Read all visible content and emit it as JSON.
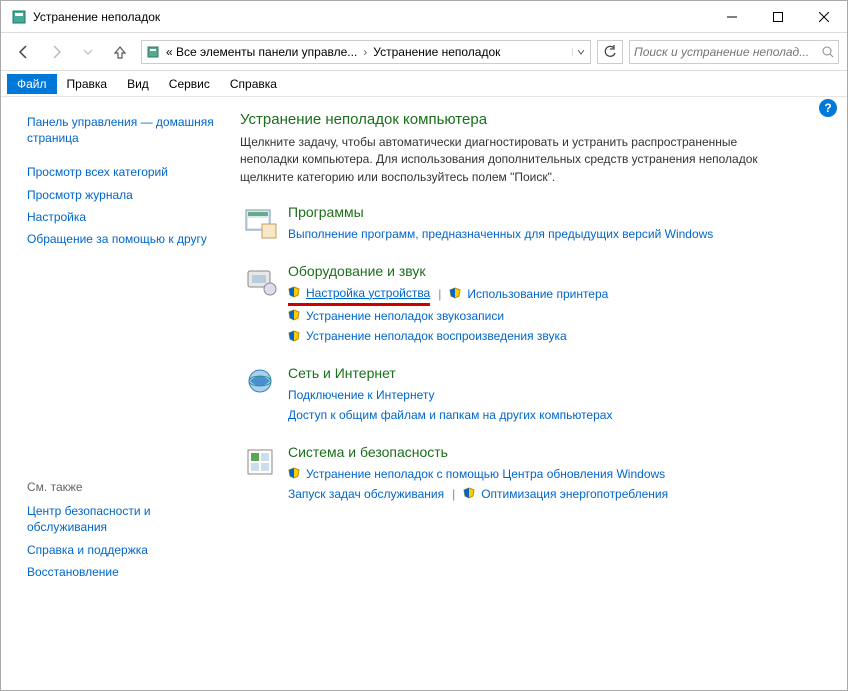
{
  "titlebar": {
    "text": "Устранение неполадок"
  },
  "addressbar": {
    "seg1": "« Все элементы панели управле...",
    "seg2": "Устранение неполадок"
  },
  "search": {
    "placeholder": "Поиск и устранение неполад..."
  },
  "menu": {
    "file": "Файл",
    "edit": "Правка",
    "view": "Вид",
    "tools": "Сервис",
    "help": "Справка"
  },
  "sidebar": {
    "home": "Панель управления — домашняя страница",
    "allcats": "Просмотр всех категорий",
    "viewlog": "Просмотр журнала",
    "settings": "Настройка",
    "askfriend": "Обращение за помощью к другу",
    "seealso": "См. также",
    "seccenter": "Центр безопасности и обслуживания",
    "helpsup": "Справка и поддержка",
    "restore": "Восстановление"
  },
  "main": {
    "heading": "Устранение неполадок компьютера",
    "desc": "Щелкните задачу, чтобы автоматически диагностировать и устранить распространенные неполадки компьютера. Для использования дополнительных средств устранения неполадок щелкните категорию или воспользуйтесь полем \"Поиск\"."
  },
  "cats": {
    "programs": {
      "title": "Программы",
      "l1": "Выполнение программ, предназначенных для предыдущих версий Windows"
    },
    "hardware": {
      "title": "Оборудование и звук",
      "l1": "Настройка устройства",
      "l2": "Использование принтера",
      "l3": "Устранение неполадок звукозаписи",
      "l4": "Устранение неполадок воспроизведения звука"
    },
    "network": {
      "title": "Сеть и Интернет",
      "l1": "Подключение к Интернету",
      "l2": "Доступ к общим файлам и папкам на других компьютерах"
    },
    "system": {
      "title": "Система и безопасность",
      "l1": "Устранение неполадок с помощью Центра обновления Windows",
      "l2": "Запуск задач обслуживания",
      "l3": "Оптимизация энергопотребления"
    }
  }
}
